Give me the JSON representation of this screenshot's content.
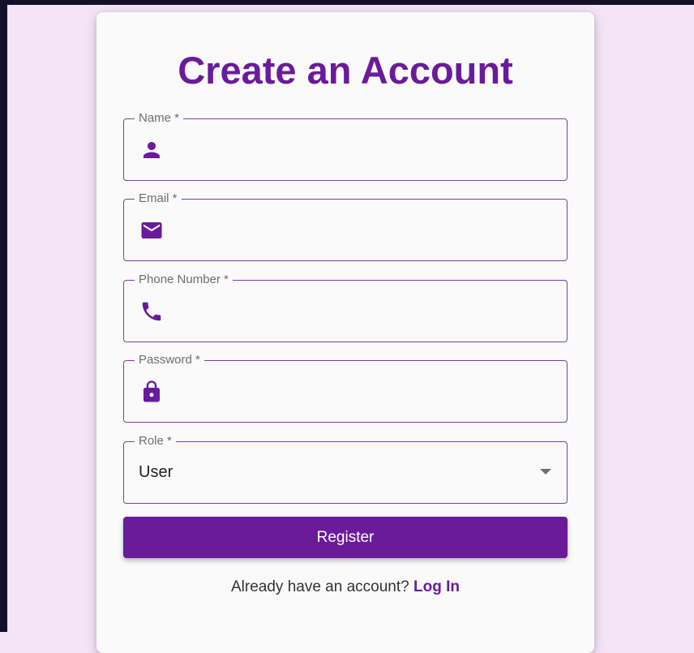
{
  "form": {
    "title": "Create an Account",
    "fields": {
      "name": {
        "label": "Name *",
        "icon": "person-icon",
        "value": ""
      },
      "email": {
        "label": "Email *",
        "icon": "email-icon",
        "value": ""
      },
      "phone": {
        "label": "Phone Number *",
        "icon": "phone-icon",
        "value": ""
      },
      "password": {
        "label": "Password *",
        "icon": "lock-icon",
        "value": ""
      },
      "role": {
        "label": "Role *",
        "selected": "User"
      }
    },
    "submit_label": "Register",
    "footer": {
      "prompt": "Already have an account?",
      "link_label": "Log In"
    }
  },
  "colors": {
    "accent": "#6a1b9a",
    "page_background": "#f3e5f5",
    "card_background": "#fafafa",
    "window_frame": "#14102a"
  }
}
